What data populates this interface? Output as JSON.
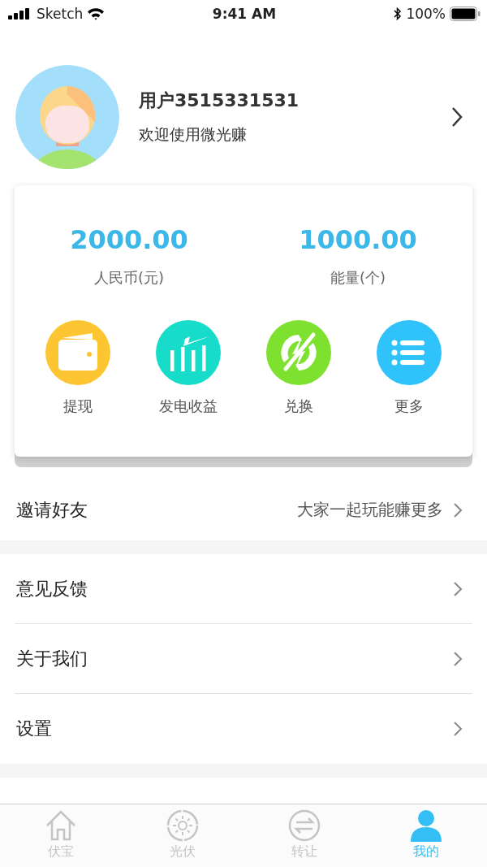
{
  "status_bar": {
    "carrier": "Sketch",
    "time": "9:41 AM",
    "battery": "100%"
  },
  "profile": {
    "name": "用户3515331531",
    "subtitle": "欢迎使用微光赚"
  },
  "balances": [
    {
      "value": "2000.00",
      "label": "人民币(元)"
    },
    {
      "value": "1000.00",
      "label": "能量(个)"
    }
  ],
  "actions": [
    {
      "kind": "wallet",
      "label": "提现",
      "color": "#fdc532"
    },
    {
      "kind": "chart",
      "label": "发电收益",
      "color": "#16dcc9"
    },
    {
      "kind": "exchange",
      "label": "兑换",
      "color": "#7ee02f"
    },
    {
      "kind": "list",
      "label": "更多",
      "color": "#30c3fb"
    }
  ],
  "invite": {
    "label": "邀请好友",
    "hint": "大家一起玩能赚更多"
  },
  "menu": [
    {
      "label": "意见反馈"
    },
    {
      "label": "关于我们"
    },
    {
      "label": "设置"
    }
  ],
  "tabs": [
    {
      "kind": "home",
      "label": "伏宝",
      "selected": false
    },
    {
      "kind": "sun",
      "label": "光伏",
      "selected": false
    },
    {
      "kind": "transfer",
      "label": "转让",
      "selected": false
    },
    {
      "kind": "person",
      "label": "我的",
      "selected": true
    }
  ]
}
